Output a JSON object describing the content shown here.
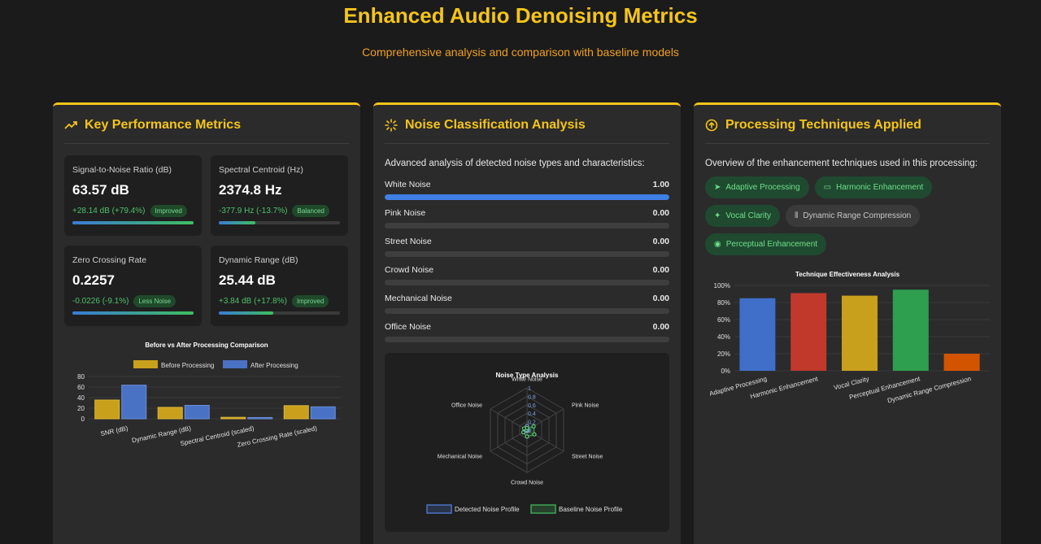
{
  "header": {
    "title": "Enhanced Audio Denoising Metrics",
    "subtitle": "Comprehensive analysis and comparison with baseline models"
  },
  "colors": {
    "accent": "#f5c518",
    "green": "#4cc26a",
    "blue": "#3f7fe6"
  },
  "key_metrics": {
    "title": "Key Performance Metrics",
    "icon": "trending-up-icon",
    "metrics": [
      {
        "label": "Signal-to-Noise Ratio (dB)",
        "value": "63.57 dB",
        "change": "+28.14 dB (+79.4%)",
        "badge": "Improved",
        "progress": 1.0,
        "change_color": "#4cc26a"
      },
      {
        "label": "Spectral Centroid (Hz)",
        "value": "2374.8 Hz",
        "change": "-377.9 Hz (-13.7%)",
        "badge": "Balanced",
        "progress": 0.3,
        "change_color": "#4cc26a"
      },
      {
        "label": "Zero Crossing Rate",
        "value": "0.2257",
        "change": "-0.0226 (-9.1%)",
        "badge": "Less Noise",
        "progress": 1.0,
        "change_color": "#4cc26a"
      },
      {
        "label": "Dynamic Range (dB)",
        "value": "25.44 dB",
        "change": "+3.84 dB (+17.8%)",
        "badge": "Improved",
        "progress": 0.45,
        "change_color": "#4cc26a"
      }
    ]
  },
  "noise_classification": {
    "title": "Noise Classification Analysis",
    "icon": "loader-icon",
    "intro": "Advanced analysis of detected noise types and characteristics:",
    "items": [
      {
        "label": "White Noise",
        "value": "1.00",
        "level": 1.0
      },
      {
        "label": "Pink Noise",
        "value": "0.00",
        "level": 0
      },
      {
        "label": "Street Noise",
        "value": "0.00",
        "level": 0
      },
      {
        "label": "Crowd Noise",
        "value": "0.00",
        "level": 0
      },
      {
        "label": "Mechanical Noise",
        "value": "0.00",
        "level": 0
      },
      {
        "label": "Office Noise",
        "value": "0.00",
        "level": 0
      }
    ]
  },
  "processing_techniques": {
    "title": "Processing Techniques Applied",
    "icon": "arrow-up-circle-icon",
    "intro": "Overview of the enhancement techniques used in this processing:",
    "tags": [
      {
        "label": "Adaptive Processing",
        "icon": "send-icon",
        "glyph": "➤",
        "active": true
      },
      {
        "label": "Harmonic Enhancement",
        "icon": "monitor-icon",
        "glyph": "▭",
        "active": true
      },
      {
        "label": "Vocal Clarity",
        "icon": "sparkle-icon",
        "glyph": "✦",
        "active": true
      },
      {
        "label": "Dynamic Range Compression",
        "icon": "waveform-icon",
        "glyph": "⦀",
        "active": false
      },
      {
        "label": "Perceptual Enhancement",
        "icon": "eye-icon",
        "glyph": "◉",
        "active": true
      }
    ]
  },
  "chart_data": [
    {
      "type": "bar",
      "title": "Before vs After Processing Comparison",
      "categories": [
        "SNR (dB)",
        "Dynamic Range (dB)",
        "Spectral Centroid (scaled)",
        "Zero Crossing Rate (scaled)"
      ],
      "series": [
        {
          "name": "Before Processing",
          "values": [
            35.4,
            21.6,
            2.8,
            24.8
          ],
          "color": "#c9a01c"
        },
        {
          "name": "After Processing",
          "values": [
            63.6,
            25.4,
            2.4,
            22.6
          ],
          "color": "#4a72c4"
        }
      ],
      "yticks": [
        0,
        20,
        40,
        60,
        80
      ],
      "ylim": [
        0,
        80
      ],
      "legend": "top"
    },
    {
      "type": "radar",
      "title": "Noise Type Analysis",
      "axes": [
        "White Noise",
        "Pink Noise",
        "Street Noise",
        "Crowd Noise",
        "Mechanical Noise",
        "Office Noise"
      ],
      "rticks": [
        "1",
        "0.8",
        "0.6",
        "0.4",
        "0.2",
        "0"
      ],
      "rlim": [
        0,
        1
      ],
      "series": [
        {
          "name": "Detected Noise Profile",
          "values": [
            0.1,
            0.02,
            0.02,
            0.02,
            0.02,
            0.02
          ],
          "color": "#4a72c4"
        },
        {
          "name": "Baseline Noise Profile",
          "values": [
            0.05,
            0.18,
            0.2,
            0.15,
            0.1,
            0.08
          ],
          "color": "#3ea657"
        }
      ],
      "legend": "bottom"
    },
    {
      "type": "bar",
      "title": "Technique Effectiveness Analysis",
      "categories": [
        "Adaptive Processing",
        "Harmonic Enhancement",
        "Vocal Clarity",
        "Perceptual Enhancement",
        "Dynamic Range Compression"
      ],
      "values": [
        85,
        91,
        88,
        95,
        20
      ],
      "colors": [
        "#3f6fc9",
        "#c0392b",
        "#c9a01c",
        "#2e9e4f",
        "#d35400"
      ],
      "yticks": [
        "0%",
        "20%",
        "40%",
        "60%",
        "80%",
        "100%"
      ],
      "ylim": [
        0,
        100
      ]
    }
  ]
}
